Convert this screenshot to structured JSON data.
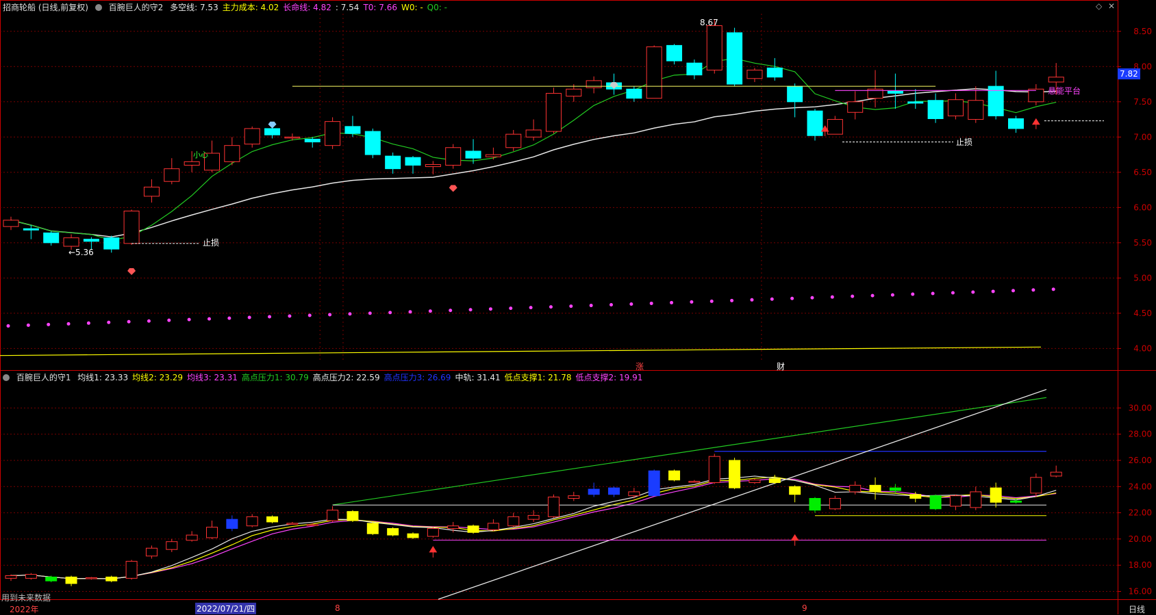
{
  "header_top": {
    "stock": "招商轮船 (日线,前复权)",
    "indicator": "百腕巨人的守2",
    "items": [
      {
        "label": "多空线:",
        "value": "7.53",
        "color": "#e8e8e8"
      },
      {
        "label": "主力成本:",
        "value": "4.02",
        "color": "#ffff00"
      },
      {
        "label": "长命线:",
        "value": "4.82",
        "color": "#ff44ff"
      },
      {
        "label": ":",
        "value": "7.54",
        "color": "#e8e8e8"
      },
      {
        "label": "T0:",
        "value": "7.66",
        "color": "#ff44ff"
      },
      {
        "label": "W0:",
        "value": "-",
        "color": "#ffff00"
      },
      {
        "label": "Q0:",
        "value": "-",
        "color": "#22cc22"
      }
    ]
  },
  "header_bottom": {
    "indicator": "百腕巨人的守1",
    "items": [
      {
        "label": "均线1:",
        "value": "23.33",
        "color": "#e8e8e8"
      },
      {
        "label": "均线2:",
        "value": "23.29",
        "color": "#ffff00"
      },
      {
        "label": "均线3:",
        "value": "23.31",
        "color": "#ff44ff"
      },
      {
        "label": "高点压力1:",
        "value": "30.79",
        "color": "#22cc22"
      },
      {
        "label": "高点压力2:",
        "value": "22.59",
        "color": "#e8e8e8"
      },
      {
        "label": "高点压力3:",
        "value": "26.69",
        "color": "#2233ff"
      },
      {
        "label": "中轨:",
        "value": "31.41",
        "color": "#e8e8e8"
      },
      {
        "label": "低点支撑1:",
        "value": "21.78",
        "color": "#ffff00"
      },
      {
        "label": "低点支撑2:",
        "value": "19.91",
        "color": "#ff44ff"
      }
    ]
  },
  "top_axis_labels": [
    "8.50",
    "8.00",
    "7.50",
    "7.00",
    "6.50",
    "6.00",
    "5.50",
    "5.00",
    "4.50",
    "4.00"
  ],
  "bottom_axis_labels": [
    "30.00",
    "28.00",
    "26.00",
    "24.00",
    "22.00",
    "20.00",
    "18.00",
    "16.00"
  ],
  "current_price": "7.82",
  "annotations": {
    "high": "8.67",
    "low": "←5.36",
    "stop_loss": "止损",
    "platform": "悬能平台",
    "xiao": "小心",
    "zhang": "涨",
    "cai": "财",
    "future_note": "用到未来数据"
  },
  "time_axis": {
    "labels": [
      "2022年",
      "2022/07/21/四",
      "8",
      "9"
    ],
    "period": "日线"
  },
  "chart_data": [
    {
      "type": "candlestick",
      "panel": "main",
      "title": "招商轮船 (日线,前复权)",
      "ylim": [
        3.8,
        8.75
      ],
      "candles": [
        [
          5.73,
          5.82,
          5.68,
          5.87
        ],
        [
          5.7,
          5.68,
          5.55,
          5.75
        ],
        [
          5.64,
          5.5,
          5.46,
          5.66
        ],
        [
          5.45,
          5.57,
          5.4,
          5.62
        ],
        [
          5.55,
          5.52,
          5.4,
          5.58
        ],
        [
          5.57,
          5.41,
          5.36,
          5.6
        ],
        [
          5.49,
          5.95,
          5.47,
          5.97
        ],
        [
          6.16,
          6.29,
          6.07,
          6.4
        ],
        [
          6.37,
          6.55,
          6.33,
          6.7
        ],
        [
          6.6,
          6.65,
          6.5,
          6.8
        ],
        [
          6.53,
          6.77,
          6.5,
          6.95
        ],
        [
          6.65,
          6.88,
          6.6,
          7.0
        ],
        [
          6.9,
          7.12,
          6.85,
          7.15
        ],
        [
          7.12,
          7.03,
          6.98,
          7.2
        ],
        [
          7.0,
          7.0,
          6.95,
          7.05
        ],
        [
          6.97,
          6.93,
          6.85,
          7.0
        ],
        [
          6.88,
          7.22,
          6.83,
          7.28
        ],
        [
          7.15,
          7.05,
          7.0,
          7.3
        ],
        [
          7.08,
          6.75,
          6.7,
          7.12
        ],
        [
          6.73,
          6.55,
          6.48,
          6.78
        ],
        [
          6.71,
          6.6,
          6.48,
          6.73
        ],
        [
          6.58,
          6.61,
          6.47,
          6.66
        ],
        [
          6.6,
          6.85,
          6.55,
          6.9
        ],
        [
          6.8,
          6.7,
          6.62,
          6.97
        ],
        [
          6.72,
          6.75,
          6.68,
          6.85
        ],
        [
          6.85,
          7.04,
          6.8,
          7.1
        ],
        [
          7.0,
          7.1,
          6.95,
          7.25
        ],
        [
          7.08,
          7.62,
          7.05,
          7.7
        ],
        [
          7.58,
          7.68,
          7.5,
          7.75
        ],
        [
          7.7,
          7.8,
          7.62,
          7.86
        ],
        [
          7.77,
          7.68,
          7.6,
          7.9
        ],
        [
          7.68,
          7.55,
          7.5,
          7.72
        ],
        [
          7.55,
          8.28,
          7.55,
          8.3
        ],
        [
          8.3,
          8.08,
          8.03,
          8.32
        ],
        [
          8.05,
          7.88,
          7.82,
          8.1
        ],
        [
          7.95,
          8.58,
          7.9,
          8.67
        ],
        [
          8.48,
          7.75,
          7.72,
          8.55
        ],
        [
          7.83,
          7.95,
          7.78,
          7.98
        ],
        [
          7.98,
          7.85,
          7.8,
          8.12
        ],
        [
          7.72,
          7.5,
          7.28,
          7.76
        ],
        [
          7.37,
          7.02,
          6.95,
          7.4
        ],
        [
          7.04,
          7.25,
          7.04,
          7.3
        ],
        [
          7.35,
          7.5,
          7.25,
          7.65
        ],
        [
          7.55,
          7.68,
          7.42,
          7.95
        ],
        [
          7.65,
          7.62,
          7.4,
          7.9
        ],
        [
          7.5,
          7.48,
          7.4,
          7.68
        ],
        [
          7.52,
          7.26,
          7.2,
          7.62
        ],
        [
          7.3,
          7.53,
          7.25,
          7.62
        ],
        [
          7.25,
          7.52,
          7.2,
          7.72
        ],
        [
          7.72,
          7.3,
          7.25,
          7.94
        ],
        [
          7.26,
          7.12,
          7.06,
          7.3
        ],
        [
          7.5,
          7.68,
          7.45,
          7.75
        ],
        [
          7.78,
          7.85,
          7.6,
          8.05
        ]
      ],
      "series": [
        {
          "name": "多空线",
          "color": "#e8e8e8"
        },
        {
          "name": "长命线",
          "color": "#ff44ff"
        },
        {
          "name": "主力成本",
          "color": "#ffff00"
        }
      ]
    },
    {
      "type": "candlestick",
      "panel": "indicator",
      "title": "百腕巨人的守1",
      "ylim": [
        15.4,
        32.0
      ],
      "candles": [
        [
          17.0,
          17.2,
          16.8,
          17.3
        ],
        [
          17.0,
          17.3,
          16.9,
          17.4
        ],
        [
          17.1,
          16.8,
          16.7,
          17.2
        ],
        [
          17.1,
          16.6,
          16.4,
          17.2
        ],
        [
          17.0,
          17.05,
          16.9,
          17.1
        ],
        [
          17.1,
          16.8,
          16.7,
          17.2
        ],
        [
          17.0,
          18.3,
          16.9,
          18.4
        ],
        [
          18.7,
          19.3,
          18.5,
          19.5
        ],
        [
          19.2,
          19.8,
          19.0,
          20.0
        ],
        [
          19.9,
          20.3,
          19.8,
          20.6
        ],
        [
          20.1,
          20.9,
          20.0,
          21.4
        ],
        [
          20.8,
          21.5,
          20.6,
          21.8
        ],
        [
          21.0,
          21.7,
          20.9,
          21.9
        ],
        [
          21.7,
          21.3,
          21.2,
          21.8
        ],
        [
          21.2,
          21.2,
          21.1,
          21.3
        ],
        [
          21.1,
          21.1,
          21.0,
          21.2
        ],
        [
          21.4,
          22.2,
          21.3,
          22.5
        ],
        [
          22.1,
          21.4,
          21.3,
          22.2
        ],
        [
          21.2,
          20.4,
          20.3,
          21.3
        ],
        [
          20.8,
          20.3,
          20.2,
          20.9
        ],
        [
          20.4,
          20.1,
          20.0,
          20.5
        ],
        [
          20.2,
          20.8,
          20.1,
          20.9
        ],
        [
          20.8,
          21.0,
          20.5,
          21.3
        ],
        [
          21.0,
          20.5,
          20.4,
          21.1
        ],
        [
          20.7,
          21.2,
          20.6,
          21.5
        ],
        [
          21.0,
          21.7,
          20.9,
          22.0
        ],
        [
          21.5,
          21.8,
          21.3,
          22.2
        ],
        [
          21.7,
          23.2,
          21.6,
          23.4
        ],
        [
          23.1,
          23.3,
          22.9,
          23.6
        ],
        [
          23.4,
          23.8,
          23.2,
          24.3
        ],
        [
          23.9,
          23.4,
          23.2,
          24.0
        ],
        [
          23.3,
          23.6,
          23.1,
          23.9
        ],
        [
          23.3,
          25.2,
          23.3,
          25.3
        ],
        [
          25.2,
          24.5,
          24.4,
          25.3
        ],
        [
          24.4,
          24.4,
          24.3,
          24.5
        ],
        [
          24.3,
          26.3,
          24.2,
          26.5
        ],
        [
          26.0,
          23.9,
          23.8,
          26.2
        ],
        [
          24.3,
          24.5,
          24.2,
          24.6
        ],
        [
          24.6,
          24.3,
          24.2,
          24.9
        ],
        [
          24.0,
          23.4,
          22.8,
          24.1
        ],
        [
          23.1,
          22.2,
          22.0,
          23.2
        ],
        [
          22.3,
          23.1,
          22.2,
          23.3
        ],
        [
          23.6,
          24.1,
          23.4,
          24.4
        ],
        [
          24.1,
          23.6,
          23.0,
          24.7
        ],
        [
          23.9,
          23.7,
          23.5,
          24.2
        ],
        [
          23.4,
          23.1,
          22.8,
          23.6
        ],
        [
          23.3,
          22.3,
          22.2,
          23.4
        ],
        [
          22.5,
          23.3,
          22.2,
          23.4
        ],
        [
          22.4,
          23.6,
          22.2,
          24.0
        ],
        [
          23.9,
          22.8,
          22.4,
          24.3
        ],
        [
          22.9,
          22.8,
          22.7,
          23.1
        ],
        [
          23.5,
          24.7,
          23.2,
          25.0
        ],
        [
          24.8,
          25.1,
          24.7,
          25.6
        ]
      ],
      "series": [
        {
          "name": "均线1",
          "value": 23.33,
          "color": "#e8e8e8"
        },
        {
          "name": "均线2",
          "value": 23.29,
          "color": "#ffff00"
        },
        {
          "name": "均线3",
          "value": 23.31,
          "color": "#ff44ff"
        },
        {
          "name": "高点压力1",
          "value": 30.79,
          "color": "#22cc22"
        },
        {
          "name": "高点压力2",
          "value": 22.59,
          "color": "#e8e8e8"
        },
        {
          "name": "高点压力3",
          "value": 26.69,
          "color": "#2233ff"
        },
        {
          "name": "中轨",
          "value": 31.41,
          "color": "#e8e8e8"
        },
        {
          "name": "低点支撑1",
          "value": 21.78,
          "color": "#ffff00"
        },
        {
          "name": "低点支撑2",
          "value": 19.91,
          "color": "#ff44ff"
        }
      ]
    }
  ],
  "colors": {
    "up": "#ff3333",
    "down_main": "#00ffff",
    "down_indicator_green": "#00ee00",
    "down_indicator_yellow": "#ffff00",
    "grid": "#7a0000",
    "axis": "#cc0000"
  }
}
